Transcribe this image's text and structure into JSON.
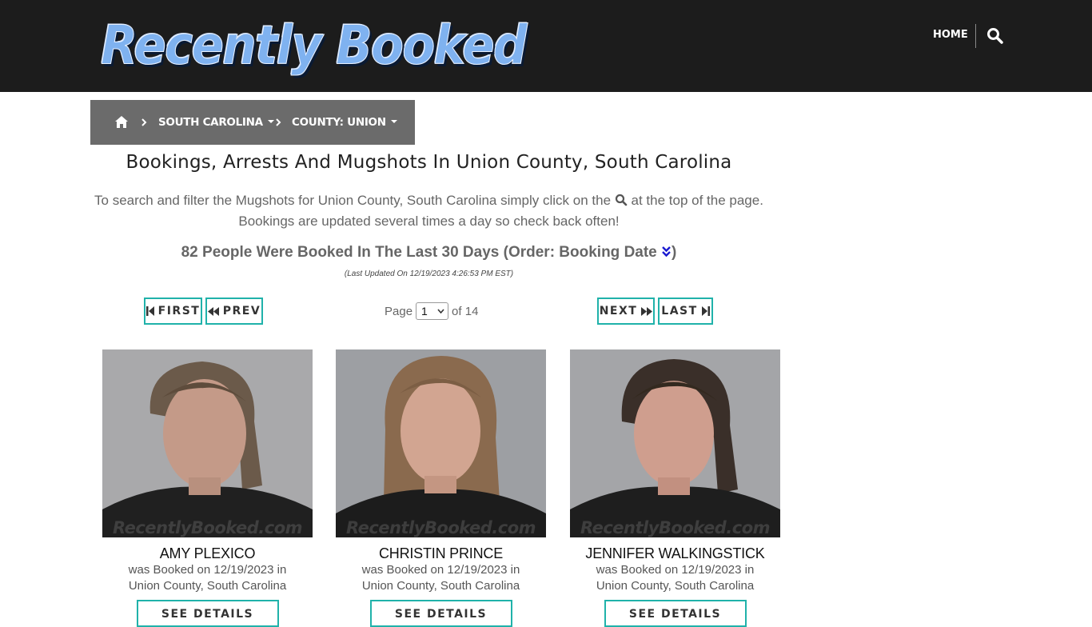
{
  "site": {
    "logo_text": "Recently Booked"
  },
  "nav": {
    "home_label": "HOME"
  },
  "breadcrumb": {
    "state_label": "SOUTH CAROLINA",
    "county_label": "COUNTY: UNION"
  },
  "page": {
    "title": "Bookings, Arrests And Mugshots In Union County, South Carolina",
    "intro_before_icon": "To search and filter the Mugshots for Union County, South Carolina simply click on the",
    "intro_after_icon": "at the top of the page.",
    "intro_line2": "Bookings are updated several times a day so check back often!",
    "count_text": "82 People Were Booked In The Last 30 Days (Order: Booking Date",
    "count_close": ")",
    "last_updated": "(Last Updated On 12/19/2023 4:26:53 PM EST)"
  },
  "pagination": {
    "first_label": "FIRST",
    "prev_label": "PREV",
    "next_label": "NEXT",
    "last_label": "LAST",
    "page_prefix": "Page",
    "current_page": "1",
    "page_suffix": "of 14"
  },
  "watermark": "RecentlyBooked.com",
  "bookings": [
    {
      "name": "AMY PLEXICO",
      "booked_line": "was Booked on 12/19/2023 in",
      "location": "Union County, South Carolina",
      "details_label": "SEE DETAILS"
    },
    {
      "name": "CHRISTIN PRINCE",
      "booked_line": "was Booked on 12/19/2023 in",
      "location": "Union County, South Carolina",
      "details_label": "SEE DETAILS"
    },
    {
      "name": "JENNIFER WALKINGSTICK",
      "booked_line": "was Booked on 12/19/2023 in",
      "location": "Union County, South Carolina",
      "details_label": "SEE DETAILS"
    }
  ],
  "colors": {
    "header_bg": "#1c1c1c",
    "breadcrumb_bg": "#6b6b6b",
    "button_border": "#20b2aa",
    "logo_blue": "#7fb2f0",
    "order_icon": "#1a1ad0"
  }
}
